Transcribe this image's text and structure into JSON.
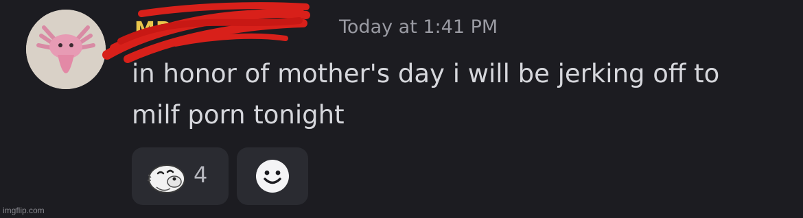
{
  "message": {
    "username": "MP",
    "timestamp": "Today at 1:41 PM",
    "text": "in honor of mother's day i will be jerking off to\nmilf porn tonight",
    "reactions": [
      {
        "emoji": "seal-emoji",
        "count": "4"
      }
    ],
    "add_reaction_icon": "smiley-face-icon"
  },
  "watermark": "imgflip.com",
  "colors": {
    "background": "#1c1c21",
    "username": "#e9c64c",
    "timestamp": "#9a9ba3",
    "text": "#d6d7dc",
    "reaction_bg": "#2a2b31",
    "redaction": "#d8201a"
  }
}
